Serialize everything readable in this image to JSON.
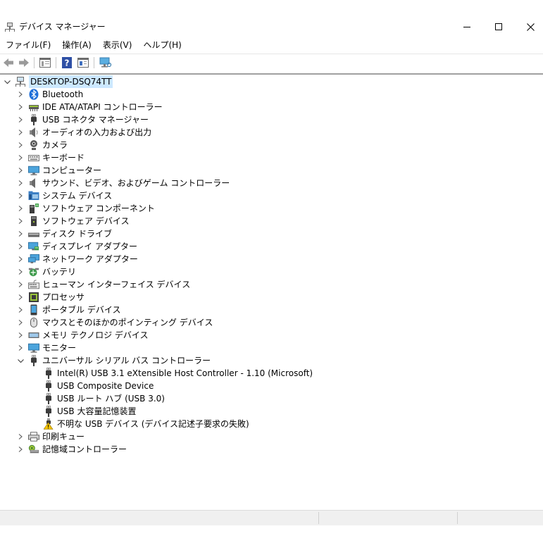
{
  "window": {
    "title": "デバイス マネージャー",
    "minimize_glyph": "—",
    "maximize_glyph": "☐",
    "close_glyph": "✕"
  },
  "menu": [
    "ファイル(F)",
    "操作(A)",
    "表示(V)",
    "ヘルプ(H)"
  ],
  "toolbar": {
    "icons": [
      "back-icon",
      "forward-icon",
      "properties-icon",
      "help-icon",
      "driver-details-icon",
      "scan-hardware-icon"
    ]
  },
  "tree": {
    "root": "DESKTOP-DSQ74TT",
    "categories": [
      {
        "label": "Bluetooth",
        "icon": "bluetooth-icon"
      },
      {
        "label": "IDE ATA/ATAPI コントローラー",
        "icon": "ide-controller-icon"
      },
      {
        "label": "USB コネクタ マネージャー",
        "icon": "usb-plug-icon"
      },
      {
        "label": "オーディオの入力および出力",
        "icon": "speaker-icon"
      },
      {
        "label": "カメラ",
        "icon": "camera-icon"
      },
      {
        "label": "キーボード",
        "icon": "keyboard-icon"
      },
      {
        "label": "コンピューター",
        "icon": "computer-icon"
      },
      {
        "label": "サウンド、ビデオ、およびゲーム コントローラー",
        "icon": "sound-icon"
      },
      {
        "label": "システム デバイス",
        "icon": "system-folder-icon"
      },
      {
        "label": "ソフトウェア コンポーネント",
        "icon": "software-component-icon"
      },
      {
        "label": "ソフトウェア デバイス",
        "icon": "software-device-icon"
      },
      {
        "label": "ディスク ドライブ",
        "icon": "disk-drive-icon"
      },
      {
        "label": "ディスプレイ アダプター",
        "icon": "display-adapter-icon"
      },
      {
        "label": "ネットワーク アダプター",
        "icon": "network-adapter-icon"
      },
      {
        "label": "バッテリ",
        "icon": "battery-icon"
      },
      {
        "label": "ヒューマン インターフェイス デバイス",
        "icon": "hid-icon"
      },
      {
        "label": "プロセッサ",
        "icon": "processor-icon"
      },
      {
        "label": "ポータブル デバイス",
        "icon": "portable-device-icon"
      },
      {
        "label": "マウスとそのほかのポインティング デバイス",
        "icon": "mouse-icon"
      },
      {
        "label": "メモリ テクノロジ デバイス",
        "icon": "memory-icon"
      },
      {
        "label": "モニター",
        "icon": "monitor-icon"
      },
      {
        "label": "ユニバーサル シリアル バス コントローラー",
        "icon": "usb-plug-icon",
        "expanded": true
      },
      {
        "label": "印刷キュー",
        "icon": "printer-icon"
      },
      {
        "label": "記憶域コントローラー",
        "icon": "storage-controller-icon"
      }
    ],
    "usb_children": [
      {
        "label": "Intel(R) USB 3.1 eXtensible Host Controller - 1.10 (Microsoft)",
        "icon": "usb-plug-icon"
      },
      {
        "label": "USB Composite Device",
        "icon": "usb-plug-icon"
      },
      {
        "label": "USB ルート ハブ (USB 3.0)",
        "icon": "usb-plug-icon"
      },
      {
        "label": "USB 大容量記憶装置",
        "icon": "usb-plug-icon"
      },
      {
        "label": "不明な USB デバイス (デバイス記述子要求の失敗)",
        "icon": "warning-usb-icon"
      }
    ]
  },
  "colors": {
    "selection": "#cce8ff",
    "bluetooth": "#1e6fd9",
    "warning": "#f2c200",
    "chevron": "#5a5a5a"
  }
}
